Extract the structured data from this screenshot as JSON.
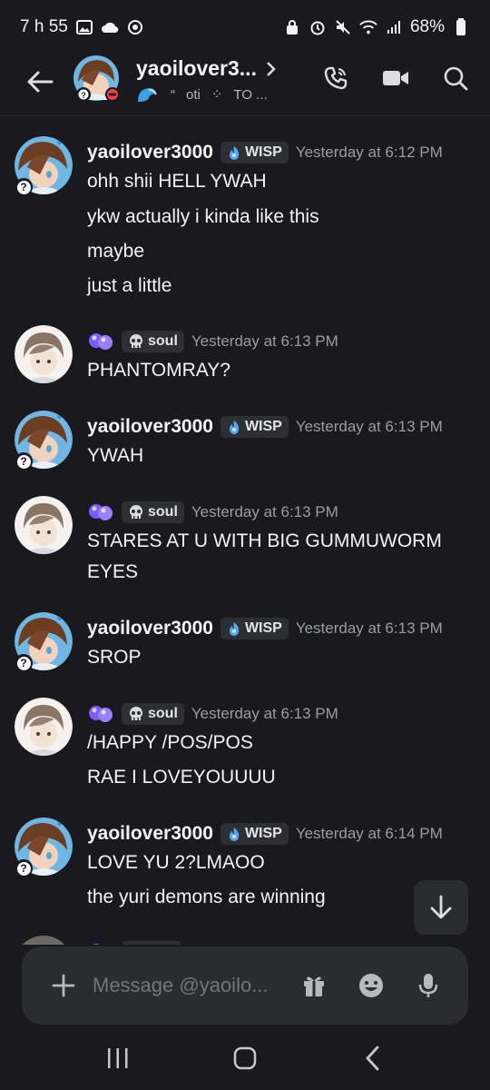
{
  "status_bar": {
    "time": "7 h 55",
    "battery": "68%",
    "icons": [
      "gallery-icon",
      "cloud-icon",
      "sync-icon",
      "lock-icon",
      "alarm-icon",
      "mute-icon",
      "wifi-icon",
      "signal-icon",
      "battery-icon"
    ]
  },
  "header": {
    "title": "yaoilover3...",
    "status_items": [
      "oti",
      "⁘",
      "TO ..."
    ],
    "actions": [
      "call-icon",
      "video-icon",
      "search-icon"
    ]
  },
  "messages": [
    {
      "author": "yaoilover3000",
      "tag": "WISP",
      "time": "Yesterday at 6:12 PM",
      "lines": [
        "ohh shii HELL YWAH",
        "ykw actually i kinda like this",
        "maybe",
        "just a little"
      ]
    },
    {
      "author": "",
      "tag": "soul",
      "time": "Yesterday at 6:13 PM",
      "lines": [
        "PHANTOMRAY?"
      ]
    },
    {
      "author": "yaoilover3000",
      "tag": "WISP",
      "time": "Yesterday at 6:13 PM",
      "lines": [
        "YWAH"
      ]
    },
    {
      "author": "",
      "tag": "soul",
      "time": "Yesterday at 6:13 PM",
      "lines": [
        "STARES AT U WITH BIG GUMMUWORM",
        "EYES"
      ]
    },
    {
      "author": "yaoilover3000",
      "tag": "WISP",
      "time": "Yesterday at 6:13 PM",
      "lines": [
        "SROP"
      ]
    },
    {
      "author": "",
      "tag": "soul",
      "time": "Yesterday at 6:13 PM",
      "lines": [
        "/HAPPY /POS/POS",
        "RAE I LOVEYOUUUU"
      ]
    },
    {
      "author": "yaoilover3000",
      "tag": "WISP",
      "time": "Yesterday at 6:14 PM",
      "lines": [
        "LOVE YU 2?LMAOO",
        "the yuri demons are winning"
      ]
    }
  ],
  "composer": {
    "placeholder": "Message @yaoilo..."
  },
  "colors": {
    "background": "#1a1a1e",
    "surface": "#2b2c31",
    "text": "#f2f3f5",
    "muted": "#9a9ca3",
    "dnd_red": "#f23f43",
    "orb_purple": "#7b5cff"
  }
}
